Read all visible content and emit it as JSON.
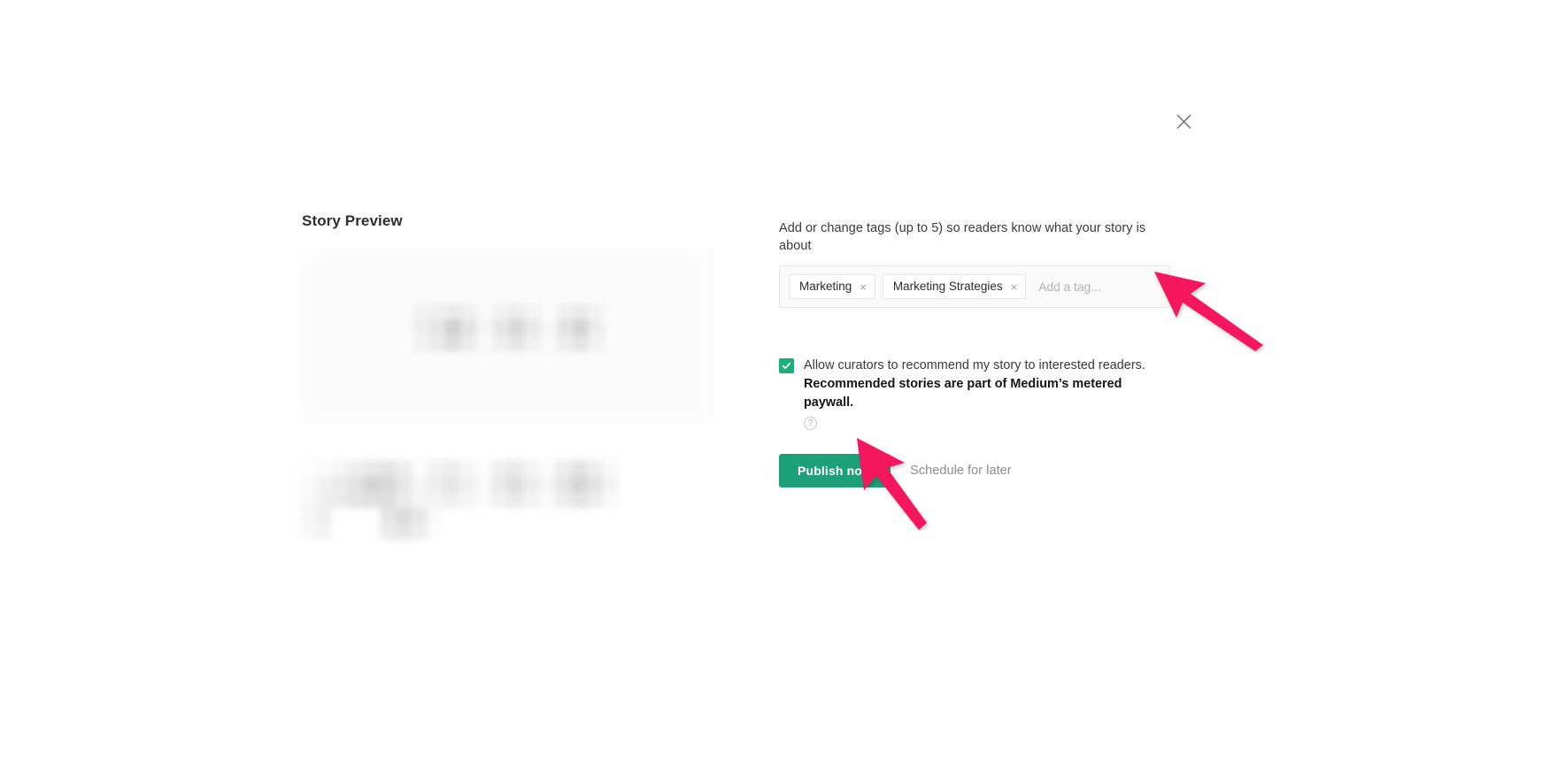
{
  "dialog": {
    "close_icon": "close-icon",
    "close_label": "Close"
  },
  "preview": {
    "heading": "Story Preview",
    "card_placeholder_alt": "blurred story title preview",
    "lower_placeholder_alt": "blurred story subtitle and meta preview"
  },
  "tags": {
    "label": "Add or change tags (up to 5) so readers know what your story is about",
    "chips": [
      {
        "name": "Marketing",
        "remove_icon": "×"
      },
      {
        "name": "Marketing Strategies",
        "remove_icon": "×"
      }
    ],
    "input_value": "",
    "input_placeholder": "Add a tag..."
  },
  "curators": {
    "checked": true,
    "checkbox_icon": "check-icon",
    "line1": "Allow curators to recommend my story to interested readers.",
    "line2": "Recommended stories are part of Medium’s metered paywall.",
    "help_icon": "?"
  },
  "actions": {
    "publish_label": "Publish now",
    "schedule_label": "Schedule for later"
  },
  "colors": {
    "brand_green": "#1CA177",
    "checkbox_green": "#1DAE7B",
    "annotation_pink": "#F4145E",
    "tag_box_bg": "#FAFAFA",
    "tag_box_border": "#E6E6E6",
    "preview_card_bg": "#FBFBFB",
    "muted_text": "#8D8D8D"
  },
  "annotations": [
    {
      "name": "arrow-to-tag-input",
      "color": "#F4145E"
    },
    {
      "name": "arrow-to-publish-button",
      "color": "#F4145E"
    }
  ],
  "pixel_blocks": {
    "title": [
      [
        "#f3f3f3",
        "#f0f0f0",
        "#ececec",
        "#f1f1f1",
        "#fafafa",
        "#f2f2f2",
        "#eeeeee",
        "#f4f4f4",
        "#fbfbfb",
        "#f0f0f0",
        "#ebebeb",
        "#f3f3f3"
      ],
      [
        "#eeeeee",
        "#e6e6e6",
        "#d2d2d2",
        "#e4e4e4",
        "#f6f6f6",
        "#e6e6e6",
        "#d9d9d9",
        "#eaeaea",
        "#f7f7f7",
        "#e3e3e3",
        "#d6d6d6",
        "#ededed"
      ],
      [
        "#f2f2f2",
        "#eaeaea",
        "#dedede",
        "#ececec",
        "#f9f9f9",
        "#eeeeee",
        "#e6e6e6",
        "#f1f1f1",
        "#fafafa",
        "#ededed",
        "#e4e4e4",
        "#f2f2f2"
      ]
    ],
    "lower": [
      [
        "#fdfdfd",
        "#fbfbfb",
        "#f6f6f6",
        "#efefef",
        "#e9e9e9",
        "#e6e6e6",
        "#eeeeee",
        "#fcfcfc",
        "#f3f3f3",
        "#eeeeee",
        "#f7f7f7",
        "#fcfcfc",
        "#f0f0f0",
        "#eaeaea",
        "#f5f5f5",
        "#fbfbfb",
        "#eeeeee",
        "#e4e4e4",
        "#eeeeee",
        "#fafafa"
      ],
      [
        "#fbfbfb",
        "#f2f2f2",
        "#ececec",
        "#e3e3e3",
        "#d4d4d4",
        "#d8d8d8",
        "#e7e7e7",
        "#f6f6f6",
        "#eeeeee",
        "#e6e6e6",
        "#f0f0f0",
        "#fafafa",
        "#eaeaea",
        "#dfdfdf",
        "#ededed",
        "#f6f6f6",
        "#e6e6e6",
        "#d6d6d6",
        "#e4e4e4",
        "#f4f4f4"
      ],
      [
        "#f8f8f8",
        "#f0f0f0",
        "#eaeaea",
        "#e4e4e4",
        "#e0e0e0",
        "#dfdfdf",
        "#ebebeb",
        "#f5f5f5",
        "#f3f3f3",
        "#efefef",
        "#f6f6f6",
        "#fcfcfc",
        "#f1f1f1",
        "#ebebeb",
        "#f3f3f3",
        "#fafafa",
        "#eeeeee",
        "#e4e4e4",
        "#eeeeee",
        "#f9f9f9"
      ],
      [
        "#f6f6f6",
        "#efefef",
        "#ffffff",
        "#ffffff",
        "#ffffff",
        "#e6e6e6",
        "#dcdcdc",
        "#e8e8e8",
        "#fbfbfb",
        "#ffffff",
        "#ffffff",
        "#ffffff",
        "#ffffff",
        "#ffffff",
        "#ffffff",
        "#ffffff",
        "#ffffff",
        "#ffffff",
        "#ffffff",
        "#ffffff"
      ],
      [
        "#f9f9f9",
        "#f4f4f4",
        "#ffffff",
        "#ffffff",
        "#ffffff",
        "#ededed",
        "#e6e6e6",
        "#eeeeee",
        "#fdfdfd",
        "#ffffff",
        "#ffffff",
        "#ffffff",
        "#ffffff",
        "#ffffff",
        "#ffffff",
        "#ffffff",
        "#ffffff",
        "#ffffff",
        "#ffffff",
        "#ffffff"
      ]
    ]
  }
}
